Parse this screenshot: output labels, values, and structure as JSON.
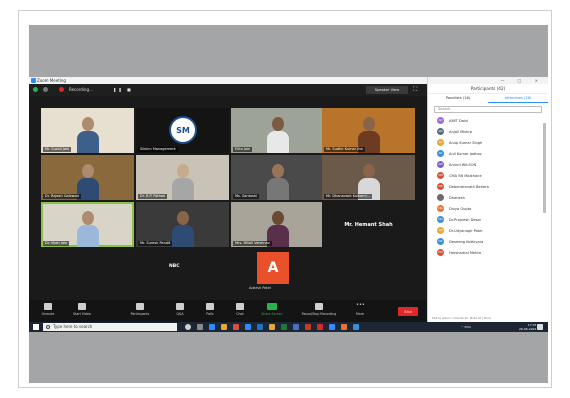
{
  "window": {
    "title": "Zoom Meeting"
  },
  "topbar": {
    "recording_label": "Recording...",
    "view_label": "Speaker View"
  },
  "tiles": [
    {
      "name": "Mr. Sushil Jain"
    },
    {
      "name": "Sikkim Management"
    },
    {
      "name": "Ekta Jain"
    },
    {
      "name": "Mr. Sudhir Kumar Jha"
    },
    {
      "name": "Dr. Rajesh Gaikwad"
    },
    {
      "name": "Dr. R.P. Pathak"
    },
    {
      "name": "Ms. Santoshi"
    },
    {
      "name": "Mr. Dhanavant Kulkarni..."
    },
    {
      "name": "Dr. Vipin Jain"
    },
    {
      "name": "Mr. Suresh Pandit"
    },
    {
      "name": "Mrs. Mitali Vaishnav"
    },
    {
      "name": "Mr. Hemant Shah"
    }
  ],
  "extra_tiles": {
    "nbc_label": "NBC",
    "avatar_letter": "A",
    "avatar_name": "Adarsh Patel"
  },
  "toolbar": {
    "unmute": "Unmute",
    "start_video": "Start Video",
    "participants": "Participants",
    "participants_count": "42",
    "qa": "Q&A",
    "polls": "Polls",
    "chat": "Chat",
    "share_screen": "Share Screen",
    "record": "Pause/Stop Recording",
    "more": "More",
    "end": "End"
  },
  "panel": {
    "title": "Participants (42)",
    "tab_panelists": "Panelists (16)",
    "tab_attendees": "Attendees (26)",
    "search_placeholder": "Search",
    "participants": [
      {
        "initials": "AD",
        "name": "AMIT Dalvi",
        "color": "#9c6ad0"
      },
      {
        "initials": "AM",
        "name": "Anjali Mishra",
        "color": "#5b6b7f"
      },
      {
        "initials": "AS",
        "name": "Anup Kumar Singh",
        "color": "#e5a63a"
      },
      {
        "initials": "AK",
        "name": "Anil Kumar Jadhav",
        "color": "#3a8fd9"
      },
      {
        "initials": "AW",
        "name": "Arvind WILSON",
        "color": "#7a5bd0"
      },
      {
        "initials": "CM",
        "name": "CMA SN Malkhane",
        "color": "#d9503a"
      },
      {
        "initials": "DB",
        "name": "Debendranath Behera",
        "color": "#d9503a"
      },
      {
        "initials": "",
        "name": "Dhanesh",
        "color": "#6b6b6b"
      },
      {
        "initials": "DG",
        "name": "Divya Gupta",
        "color": "#e5743a"
      },
      {
        "initials": "DD",
        "name": "Dr.Prajnesh Desai",
        "color": "#3a8fd9"
      },
      {
        "initials": "DP",
        "name": "Dr.Udyanagir Patel",
        "color": "#e5a63a"
      },
      {
        "initials": "DK",
        "name": "Deveeng Kothiyara",
        "color": "#3a8fd9"
      },
      {
        "initials": "HM",
        "name": "Harshadrai Mehta",
        "color": "#d9503a"
      }
    ],
    "footer": "Talk to admin: Unmute All, Mute All | More"
  },
  "taskbar": {
    "search_placeholder": "Type here to search",
    "tray": "^ ENG",
    "time": "17:07",
    "date": "26-06-2021"
  }
}
